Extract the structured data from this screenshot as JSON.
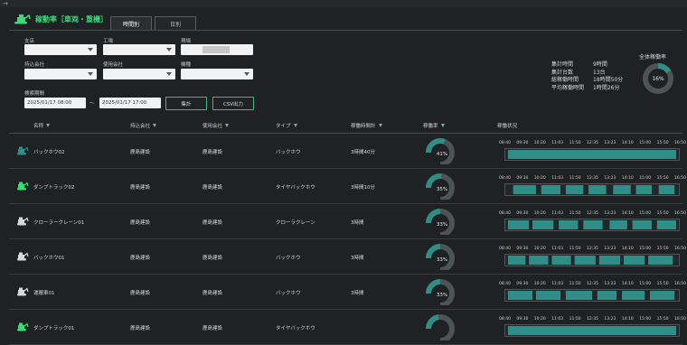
{
  "app": {
    "title": "稼動率［車両・重機］",
    "top_glyph": "→",
    "tabs": [
      {
        "label": "時間別"
      },
      {
        "label": "日別"
      }
    ]
  },
  "filters": {
    "branch_label": "支店",
    "site_label": "工場",
    "field_label": "現場",
    "field_value": "",
    "owner_label": "持込会社",
    "user_label": "使用会社",
    "machine_label": "機種",
    "period_label": "検索期間",
    "start": "2025/01/17 08:00",
    "end": "2025/01/17 17:00",
    "separator": "〜",
    "aggregate_button": "集計",
    "csv_button": "CSV出力"
  },
  "summary": {
    "total_time_label": "集計時間",
    "total_time_value": "9時間",
    "count_label": "集計台数",
    "count_value": "13台",
    "operating_label": "総稼働時間",
    "operating_value": "18時間50分",
    "average_label": "平均稼働時間",
    "average_value": "1時間26分",
    "overall_label": "全体稼働率",
    "overall_value": "16%",
    "overall_rate": 0.16
  },
  "table": {
    "headers": [
      "名称",
      "持込会社",
      "使用会社",
      "タイプ",
      "稼働時間計",
      "稼働率",
      "稼働状況"
    ],
    "rows": [
      {
        "name": "バックホウ02",
        "owner": "鹿島建設",
        "user": "鹿島建設",
        "type": "バックホウ",
        "time": "3時間40分",
        "rate": "41%",
        "rate_value": 0.41,
        "color": "#2f8f88",
        "segments": [
          [
            0.02,
            0.98
          ]
        ]
      },
      {
        "name": "ダンプトラック02",
        "owner": "鹿島建設",
        "user": "鹿島建設",
        "type": "タイヤバックホウ",
        "time": "3時間10分",
        "rate": "35%",
        "rate_value": 0.35,
        "color": "#3cd97a",
        "segments": [
          [
            0.05,
            0.18
          ],
          [
            0.21,
            0.32
          ],
          [
            0.35,
            0.45
          ],
          [
            0.48,
            0.58
          ],
          [
            0.62,
            0.72
          ],
          [
            0.75,
            0.84
          ],
          [
            0.88,
            0.97
          ]
        ]
      },
      {
        "name": "クローラークレーン01",
        "owner": "鹿島建設",
        "user": "鹿島建設",
        "type": "クローラクレーン",
        "time": "3時間",
        "rate": "33%",
        "rate_value": 0.33,
        "color": "#d8d8d8",
        "segments": [
          [
            0.02,
            0.14
          ],
          [
            0.16,
            0.28
          ],
          [
            0.31,
            0.42
          ],
          [
            0.45,
            0.56
          ],
          [
            0.6,
            0.7
          ],
          [
            0.73,
            0.84
          ],
          [
            0.87,
            0.98
          ]
        ]
      },
      {
        "name": "バックホウ01",
        "owner": "鹿島建設",
        "user": "鹿島建設",
        "type": "バックホウ",
        "time": "3時間",
        "rate": "33%",
        "rate_value": 0.33,
        "color": "#d8d8d8",
        "segments": [
          [
            0.02,
            0.12
          ],
          [
            0.14,
            0.25
          ],
          [
            0.27,
            0.38
          ],
          [
            0.4,
            0.52
          ],
          [
            0.54,
            0.66
          ],
          [
            0.68,
            0.8
          ],
          [
            0.82,
            0.96
          ]
        ]
      },
      {
        "name": "運搬車01",
        "owner": "鹿島建設",
        "user": "鹿島建設",
        "type": "バックホウ",
        "time": "3時間",
        "rate": "33%",
        "rate_value": 0.33,
        "color": "#d8d8d8",
        "segments": [
          [
            0.02,
            0.16
          ],
          [
            0.18,
            0.32
          ],
          [
            0.35,
            0.5
          ],
          [
            0.53,
            0.64
          ],
          [
            0.67,
            0.8
          ],
          [
            0.83,
            0.97
          ]
        ]
      },
      {
        "name": "ダンプトラック01",
        "owner": "鹿島建設",
        "user": "鹿島建設",
        "type": "タイヤバックホウ",
        "time": "",
        "rate": "",
        "rate_value": 0.3,
        "color": "#3cd97a",
        "segments": [
          [
            0.02,
            0.98
          ]
        ]
      }
    ],
    "time_ticks": [
      "08:40",
      "09:30",
      "10:20",
      "11:03",
      "11:50",
      "12:35",
      "13:23",
      "14:10",
      "15:00",
      "15:50",
      "16:50"
    ]
  }
}
